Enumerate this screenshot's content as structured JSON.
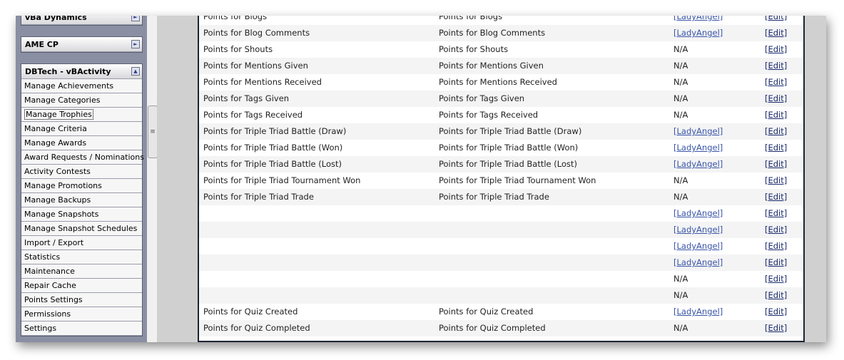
{
  "sidebar": {
    "groups": [
      {
        "title": "vBa Dynamics",
        "toggle": "►"
      },
      {
        "title": "AME CP",
        "toggle": "►"
      },
      {
        "title": "DBTech - vBActivity",
        "toggle": "▲"
      }
    ],
    "items": [
      "Manage Achievements",
      "Manage Categories",
      "Manage Trophies",
      "Manage Criteria",
      "Manage Awards",
      "Award Requests / Nominations",
      "Activity Contests",
      "Manage Promotions",
      "Manage Backups",
      "Manage Snapshots",
      "Manage Snapshot Schedules",
      "Import / Export",
      "Statistics",
      "Maintenance",
      "Repair Cache",
      "Points Settings",
      "Permissions",
      "Settings"
    ]
  },
  "table": {
    "rows": [
      {
        "title": "Points for Blogs",
        "varname": "Points for Blogs",
        "user": "[LadyAngel]",
        "edit": "[Edit]"
      },
      {
        "title": "Points for Blog Comments",
        "varname": "Points for Blog Comments",
        "user": "[LadyAngel]",
        "edit": "[Edit]"
      },
      {
        "title": "Points for Shouts",
        "varname": "Points for Shouts",
        "user": "N/A",
        "edit": "[Edit]"
      },
      {
        "title": "Points for Mentions Given",
        "varname": "Points for Mentions Given",
        "user": "N/A",
        "edit": "[Edit]"
      },
      {
        "title": "Points for Mentions Received",
        "varname": "Points for Mentions Received",
        "user": "N/A",
        "edit": "[Edit]"
      },
      {
        "title": "Points for Tags Given",
        "varname": "Points for Tags Given",
        "user": "N/A",
        "edit": "[Edit]"
      },
      {
        "title": "Points for Tags Received",
        "varname": "Points for Tags Received",
        "user": "N/A",
        "edit": "[Edit]"
      },
      {
        "title": "Points for Triple Triad Battle (Draw)",
        "varname": "Points for Triple Triad Battle (Draw)",
        "user": "[LadyAngel]",
        "edit": "[Edit]"
      },
      {
        "title": "Points for Triple Triad Battle (Won)",
        "varname": "Points for Triple Triad Battle (Won)",
        "user": "[LadyAngel]",
        "edit": "[Edit]"
      },
      {
        "title": "Points for Triple Triad Battle (Lost)",
        "varname": "Points for Triple Triad Battle (Lost)",
        "user": "[LadyAngel]",
        "edit": "[Edit]"
      },
      {
        "title": "Points for Triple Triad Tournament Won",
        "varname": "Points for Triple Triad Tournament Won",
        "user": "N/A",
        "edit": "[Edit]"
      },
      {
        "title": "Points for Triple Triad Trade",
        "varname": "Points for Triple Triad Trade",
        "user": "N/A",
        "edit": "[Edit]"
      },
      {
        "title": "",
        "varname": "",
        "user": "[LadyAngel]",
        "edit": "[Edit]"
      },
      {
        "title": "",
        "varname": "",
        "user": "[LadyAngel]",
        "edit": "[Edit]"
      },
      {
        "title": "",
        "varname": "",
        "user": "[LadyAngel]",
        "edit": "[Edit]"
      },
      {
        "title": "",
        "varname": "",
        "user": "[LadyAngel]",
        "edit": "[Edit]"
      },
      {
        "title": "",
        "varname": "",
        "user": "N/A",
        "edit": "[Edit]"
      },
      {
        "title": "",
        "varname": "",
        "user": "N/A",
        "edit": "[Edit]"
      },
      {
        "title": "Points for Quiz Created",
        "varname": "Points for Quiz Created",
        "user": "[LadyAngel]",
        "edit": "[Edit]"
      },
      {
        "title": "Points for Quiz Completed",
        "varname": "Points for Quiz Completed",
        "user": "N/A",
        "edit": "[Edit]"
      }
    ]
  },
  "splitter": {
    "grip": "≡"
  },
  "colors": {
    "sidebar_bg": "#8a8fa3",
    "link": "#3a55a8",
    "table_border": "#1b2434"
  }
}
